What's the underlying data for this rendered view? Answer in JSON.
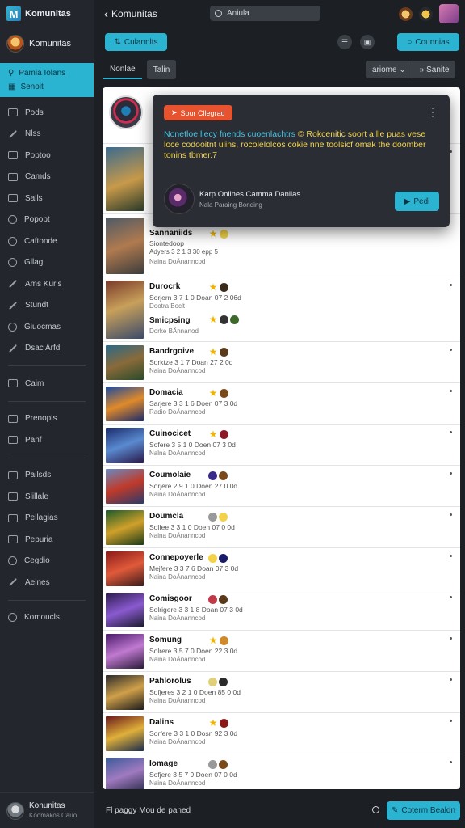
{
  "app": {
    "logo_text": "Komunitas",
    "title": "Komunitas"
  },
  "search": {
    "value": "Aniula"
  },
  "sidebar": {
    "profile_name": "Komunitas",
    "active_top": "Pamia Iolans",
    "active_bottom": "Senoit",
    "group1": [
      "Pods",
      "Nlss",
      "Poptoo",
      "Camds",
      "Salls",
      "Popobt",
      "Caftonde",
      "Gllag",
      "Ams Kurls",
      "Stundt",
      "Giuocmas",
      "Dsac Arfd"
    ],
    "group2": [
      "Caim"
    ],
    "group3": [
      "Prenopls",
      "Panf"
    ],
    "group4": [
      "Pailsds",
      "Slillale",
      "Pellagias",
      "Pepuria",
      "Cegdio",
      "Aelnes"
    ],
    "group5": [
      "Komoucls"
    ],
    "footer_name": "Konunitas",
    "footer_sub": "Koomakos Cauo"
  },
  "toolbar": {
    "left_button": "Culannlts",
    "right_button": "Counnias"
  },
  "tabs": [
    {
      "label": "Nonlae"
    },
    {
      "label": "Talin"
    }
  ],
  "sort": {
    "left": "ariome",
    "right": "Sanite"
  },
  "popup": {
    "badge": "Sour Cllegrad",
    "text_hl": "Nonetloe liecy fnends cuoenlachtrs",
    "text_rest": "© Rokcenitic soort a lle puas vese loce codooitnt ulins, rocolelolcos cokie nne toolsicf omak the doomber tonins tbmer.7",
    "author_name": "Karp Onlines Camma Danilas",
    "author_sub": "Nala Paraing Bonding",
    "button": "Pedi"
  },
  "games": [
    {
      "title": "Sannaniids",
      "meta": "Siontedoop",
      "sub": "Adyers 3 2 1 3 30 epp 5",
      "sub2": "Naina DoÄnanncod"
    },
    {
      "title": "Durocrk",
      "meta": "Sorjern 3 7 1 0  Doan 07 2 06d",
      "sub": "Dootra Boclt",
      "title2": "Smicpsing",
      "sub2": "Dorke BÄnnanod"
    },
    {
      "title": "Bandrgoive",
      "meta": "Sorktze 3 1 7  Doan 27 2 0d",
      "sub": "Naina DoÄnanncod"
    },
    {
      "title": "Domacia",
      "meta": "Sarjere 3 3 1 6  Doen 07 3 0d",
      "sub": "Radio DoÄnanncod"
    },
    {
      "title": "Cuinocicet",
      "meta": "Sofere 3 5 1 0  Doen 07 3 0d",
      "sub": "Nalna DoÄnanncod"
    },
    {
      "title": "Coumolaie",
      "meta": "Sorjere 2 9 1 0  Doen 27 0 0d",
      "sub": "Naina DoÄnanncod"
    },
    {
      "title": "Doumcla",
      "meta": "Solfee 3 3 1 0  Doen 07 0 0d",
      "sub": "Naina DoÄnanncod"
    },
    {
      "title": "Connepoyerle",
      "meta": "Mejfere 3 3 7 6  Doan 07 3 0d",
      "sub": "Naina DoÄnanncod"
    },
    {
      "title": "Comisgoor",
      "meta": "Solrigere 3 3 1 8  Doan 07 3 0d",
      "sub": "Naina DoÄnanncod"
    },
    {
      "title": "Somung",
      "meta": "Solrere 3 5 7 0  Doen 22 3 0d",
      "sub": "Naina DoÄnanncod"
    },
    {
      "title": "Pahlorolus",
      "meta": "Sofjeres 3 2 1 0  Doen 85 0 0d",
      "sub": "Naina DoÄnanncod"
    },
    {
      "title": "Dalins",
      "meta": "Sorfere 3 3 1 0  Dosn 92 3 0d",
      "sub": "Naina DoÄnanncod"
    },
    {
      "title": "Iomage",
      "meta": "Sofjere 3 5 7 9  Doen 07 0 0d",
      "sub": "Naina DoÄnanncod"
    }
  ],
  "bottom": {
    "text": "Fl paggy Mou de paned",
    "button": "Coterm Bealdn"
  },
  "colors": {
    "accent": "#2bb3d2",
    "badge": "#e8532f",
    "sidebar": "#23272d",
    "background": "#1c1f24"
  }
}
